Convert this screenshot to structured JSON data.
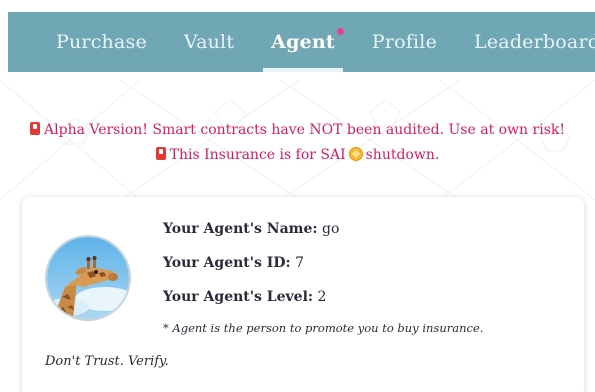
{
  "nav": {
    "items": [
      {
        "label": "Purchase"
      },
      {
        "label": "Vault"
      },
      {
        "label": "Agent"
      },
      {
        "label": "Profile"
      },
      {
        "label": "Leaderboard"
      }
    ],
    "active": "Agent"
  },
  "notices": {
    "alpha": "Alpha Version! Smart contracts have NOT been audited. Use at own risk!",
    "insurance_prefix": "This Insurance is for SAI",
    "insurance_suffix": "shutdown."
  },
  "agent": {
    "name_label": "Your Agent's Name:",
    "name_value": "go",
    "id_label": "Your Agent's ID:",
    "id_value": "7",
    "level_label": "Your Agent's Level:",
    "level_value": "2",
    "footnote": "* Agent is the person to promote you to buy insurance.",
    "motto": "Don't Trust. Verify."
  },
  "colors": {
    "topbar": "#6fa7b4",
    "notice": "#d81b60",
    "badge_dot": "#e2408a"
  },
  "icons": {
    "warning": "warning-icon",
    "coin": "sai-coin-icon",
    "avatar": "giraffe-avatar"
  }
}
